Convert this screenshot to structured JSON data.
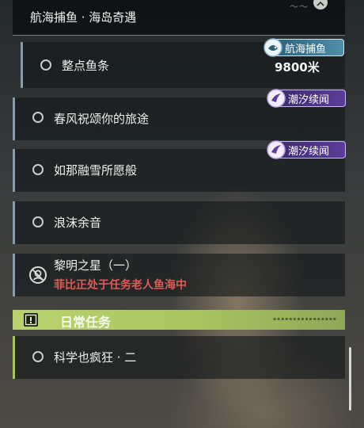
{
  "header": {
    "title": "航海捕鱼 · 海岛奇遇"
  },
  "quests": [
    {
      "label": "整点鱼条",
      "badge": "航海捕鱼",
      "detail": "9800米"
    },
    {
      "label": "春风祝颂你的旅途",
      "badge": "潮汐续闻"
    },
    {
      "label": "如那融雪所愿般",
      "badge": "潮汐续闻"
    },
    {
      "label": "浪沫余音"
    },
    {
      "label": "黎明之星（一）",
      "warning": "菲比正处于任务老人鱼海中"
    }
  ],
  "daily": {
    "label": "日常任务",
    "quests": [
      {
        "label": "科学也疯狂 · 二"
      }
    ]
  },
  "colors": {
    "sidebar": "#8a9aa6",
    "daily_accent": "#b9d36f",
    "warning": "#e05a55",
    "badge_purple": "#5c3d9a",
    "badge_teal": "#4f8fa8"
  }
}
